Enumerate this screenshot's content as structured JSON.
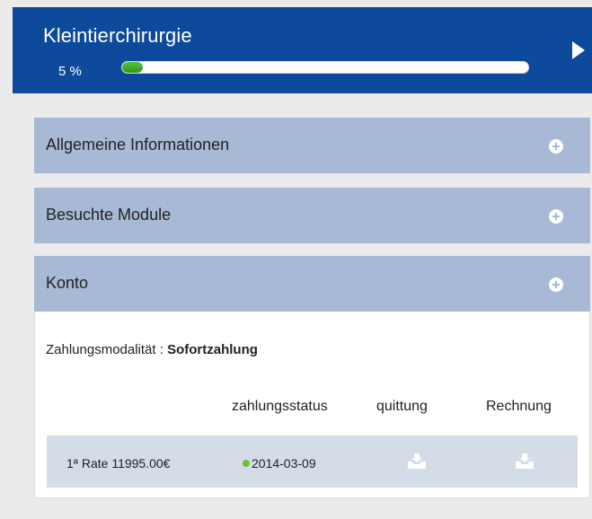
{
  "course": {
    "title": "Kleintierchirurgie",
    "progress_label": "5 %",
    "progress_fraction": 0.05,
    "progress_color": "#3aa825",
    "header_color": "#0d4a9b"
  },
  "sections": [
    {
      "label": "Allgemeine Informationen"
    },
    {
      "label": "Besuchte Module"
    },
    {
      "label": "Konto"
    }
  ],
  "konto": {
    "payment_mode_label": "Zahlungsmodalität :",
    "payment_mode_value": "Sofortzahlung",
    "columns": {
      "status": "zahlungsstatus",
      "quittung": "quittung",
      "rechnung": "Rechnung"
    },
    "rows": [
      {
        "label": "1ª Rate 11995.00€",
        "status_date": "2014-03-09",
        "status_color": "#6abf3a",
        "quittung_icon": "download-icon",
        "rechnung_icon": "download-icon"
      }
    ]
  },
  "icons": {
    "header_action": "play-icon",
    "section_toggle": "plus-circle-icon"
  }
}
